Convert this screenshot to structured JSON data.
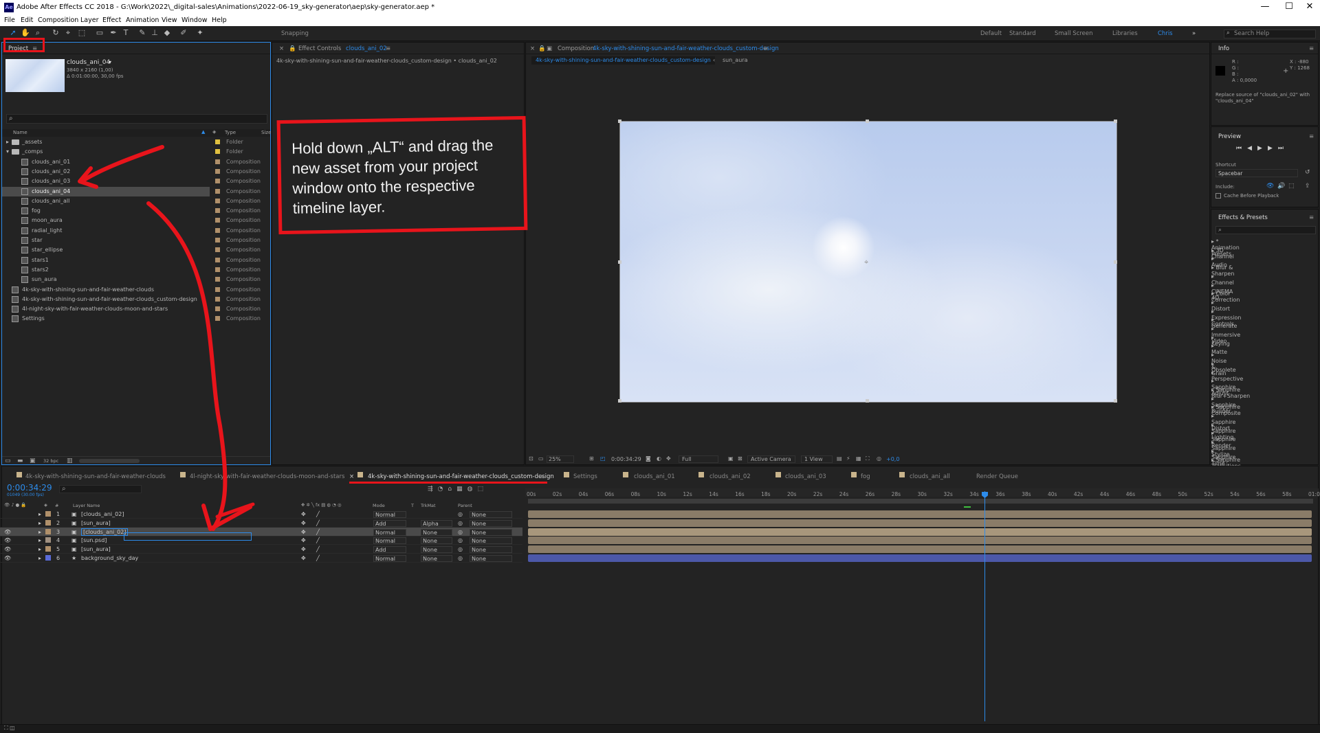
{
  "app": {
    "title": "Adobe After Effects CC 2018 - G:\\Work\\2022\\_digital-sales\\Animations\\2022-06-19_sky-generator\\aep\\sky-generator.aep *",
    "logo": "Ae"
  },
  "menu": [
    "File",
    "Edit",
    "Composition",
    "Layer",
    "Effect",
    "Animation",
    "View",
    "Window",
    "Help"
  ],
  "toolbar": {
    "snapping": "Snapping",
    "workspaces": [
      "Default",
      "Standard",
      "Small Screen",
      "Libraries",
      "Chris"
    ],
    "search_placeholder": "Search Help"
  },
  "project": {
    "tab": "Project",
    "selected_name": "clouds_ani_04",
    "selected_info1": "3840 x 2160 (1,00)",
    "selected_info2": "Δ 0:01:00:00, 30,00 fps",
    "col_name": "Name",
    "col_type": "Type",
    "col_size": "Size",
    "bpc": "32 bpc",
    "items": [
      {
        "name": "_assets",
        "type": "Folder",
        "kind": "folder",
        "indent": 0,
        "lab": "#e0c040"
      },
      {
        "name": "_comps",
        "type": "Folder",
        "kind": "folder",
        "indent": 0,
        "lab": "#e0c040"
      },
      {
        "name": "clouds_ani_01",
        "type": "Composition",
        "kind": "comp",
        "indent": 1,
        "lab": "#b0906a"
      },
      {
        "name": "clouds_ani_02",
        "type": "Composition",
        "kind": "comp",
        "indent": 1,
        "lab": "#b0906a"
      },
      {
        "name": "clouds_ani_03",
        "type": "Composition",
        "kind": "comp",
        "indent": 1,
        "lab": "#b0906a"
      },
      {
        "name": "clouds_ani_04",
        "type": "Composition",
        "kind": "comp",
        "indent": 1,
        "lab": "#b0906a",
        "selected": true
      },
      {
        "name": "clouds_ani_all",
        "type": "Composition",
        "kind": "comp",
        "indent": 1,
        "lab": "#b0906a"
      },
      {
        "name": "fog",
        "type": "Composition",
        "kind": "comp",
        "indent": 1,
        "lab": "#b0906a"
      },
      {
        "name": "moon_aura",
        "type": "Composition",
        "kind": "comp",
        "indent": 1,
        "lab": "#b0906a"
      },
      {
        "name": "radial_light",
        "type": "Composition",
        "kind": "comp",
        "indent": 1,
        "lab": "#b0906a"
      },
      {
        "name": "star",
        "type": "Composition",
        "kind": "comp",
        "indent": 1,
        "lab": "#b0906a"
      },
      {
        "name": "star_ellipse",
        "type": "Composition",
        "kind": "comp",
        "indent": 1,
        "lab": "#b0906a"
      },
      {
        "name": "stars1",
        "type": "Composition",
        "kind": "comp",
        "indent": 1,
        "lab": "#b0906a"
      },
      {
        "name": "stars2",
        "type": "Composition",
        "kind": "comp",
        "indent": 1,
        "lab": "#b0906a"
      },
      {
        "name": "sun_aura",
        "type": "Composition",
        "kind": "comp",
        "indent": 1,
        "lab": "#b0906a"
      },
      {
        "name": "4k-sky-with-shining-sun-and-fair-weather-clouds",
        "type": "Composition",
        "kind": "comp",
        "indent": 0,
        "lab": "#b0906a"
      },
      {
        "name": "4k-sky-with-shining-sun-and-fair-weather-clouds_custom-design",
        "type": "Composition",
        "kind": "comp",
        "indent": 0,
        "lab": "#b0906a"
      },
      {
        "name": "4l-night-sky-with-fair-weather-clouds-moon-and-stars",
        "type": "Composition",
        "kind": "comp",
        "indent": 0,
        "lab": "#b0906a"
      },
      {
        "name": "Settings",
        "type": "Composition",
        "kind": "comp",
        "indent": 0,
        "lab": "#b0906a"
      }
    ]
  },
  "effect_controls": {
    "tab": "Effect Controls",
    "tab_target": "clouds_ani_02",
    "path": "4k-sky-with-shining-sun-and-fair-weather-clouds_custom-design • clouds_ani_02"
  },
  "annotation": {
    "text": "Hold down „ALT“ and drag the new asset from your project window onto the respective timeline layer.",
    "color": "#e8141b"
  },
  "composition": {
    "tab": "Composition",
    "tab_target": "4k-sky-with-shining-sun-and-fair-weather-clouds_custom-design",
    "crumb1": "4k-sky-with-shining-sun-and-fair-weather-clouds_custom-design",
    "crumb2": "sun_aura",
    "zoom": "25%",
    "timecode": "0:00:34:29",
    "resolution": "Full",
    "camera": "Active Camera",
    "views": "1 View",
    "exposure": "+0,0"
  },
  "info": {
    "title": "Info",
    "r": "R :",
    "g": "G :",
    "b": "B :",
    "a": "A :  0,0000",
    "x": "X : -880",
    "y": "Y : 1268",
    "message": "Replace source of \"clouds_ani_02\" with \"clouds_ani_04\""
  },
  "preview": {
    "title": "Preview",
    "shortcut_label": "Shortcut",
    "shortcut": "Spacebar",
    "include": "Include:",
    "cache": "Cache Before Playback"
  },
  "effects": {
    "title": "Effects & Presets",
    "items": [
      "* Animation Presets",
      "3D Channel",
      "Audio",
      "Blur & Sharpen",
      "Channel",
      "CINEMA 4D",
      "Color Correction",
      "Distort",
      "Expression Controls",
      "Generate",
      "Immersive Video",
      "Keying",
      "Matte",
      "Noise & Grain",
      "Obsolete",
      "Perspective",
      "Sapphire Adjust",
      "Sapphire Blur+Sharpen",
      "Sapphire Builder",
      "Sapphire Composite",
      "Sapphire Distort",
      "Sapphire Lighting",
      "Sapphire Render",
      "Sapphire Stylize",
      "Sapphire Time",
      "Sapphire Transitions"
    ]
  },
  "timeline": {
    "tabs": [
      "4k-sky-with-shining-sun-and-fair-weather-clouds",
      "4l-night-sky-with-fair-weather-clouds-moon-and-stars",
      "4k-sky-with-shining-sun-and-fair-weather-clouds_custom-design",
      "Settings",
      "clouds_ani_01",
      "clouds_ani_02",
      "clouds_ani_03",
      "fog",
      "clouds_ani_all",
      "Render Queue"
    ],
    "timecode": "0:00:34:29",
    "fps": "01049 (30.00 fps)",
    "col_layer": "Layer Name",
    "col_mode": "Mode",
    "col_t": "T",
    "col_trkmat": "TrkMat",
    "col_parent": "Parent",
    "ticks": [
      "00s",
      "02s",
      "04s",
      "06s",
      "08s",
      "10s",
      "12s",
      "14s",
      "16s",
      "18s",
      "20s",
      "22s",
      "24s",
      "26s",
      "28s",
      "30s",
      "32s",
      "34s",
      "36s",
      "38s",
      "40s",
      "42s",
      "44s",
      "46s",
      "48s",
      "50s",
      "52s",
      "54s",
      "56s",
      "58s",
      "01:0"
    ],
    "layers": [
      {
        "num": "1",
        "name": "[clouds_ani_02]",
        "mode": "Normal",
        "trk": "",
        "parent": "None",
        "lab": "#b0906a",
        "bar": "#8a7c68"
      },
      {
        "num": "2",
        "name": "[sun_aura]",
        "mode": "Add",
        "trk": "Alpha",
        "parent": "None",
        "lab": "#b0906a",
        "bar": "#8a7c68"
      },
      {
        "num": "3",
        "name": "[clouds_ani_02]",
        "mode": "Normal",
        "trk": "None",
        "parent": "None",
        "lab": "#b0906a",
        "bar": "#a8977c",
        "selected": true
      },
      {
        "num": "4",
        "name": "[sun.psd]",
        "mode": "Normal",
        "trk": "None",
        "parent": "None",
        "lab": "#a09080",
        "bar": "#8a7c68"
      },
      {
        "num": "5",
        "name": "[sun_aura]",
        "mode": "Add",
        "trk": "None",
        "parent": "None",
        "lab": "#b0906a",
        "bar": "#8a7c68"
      },
      {
        "num": "6",
        "name": "background_sky_day",
        "mode": "Normal",
        "trk": "None",
        "parent": "None",
        "lab": "#5a6bd8",
        "bar": "#4c58a8"
      }
    ]
  }
}
